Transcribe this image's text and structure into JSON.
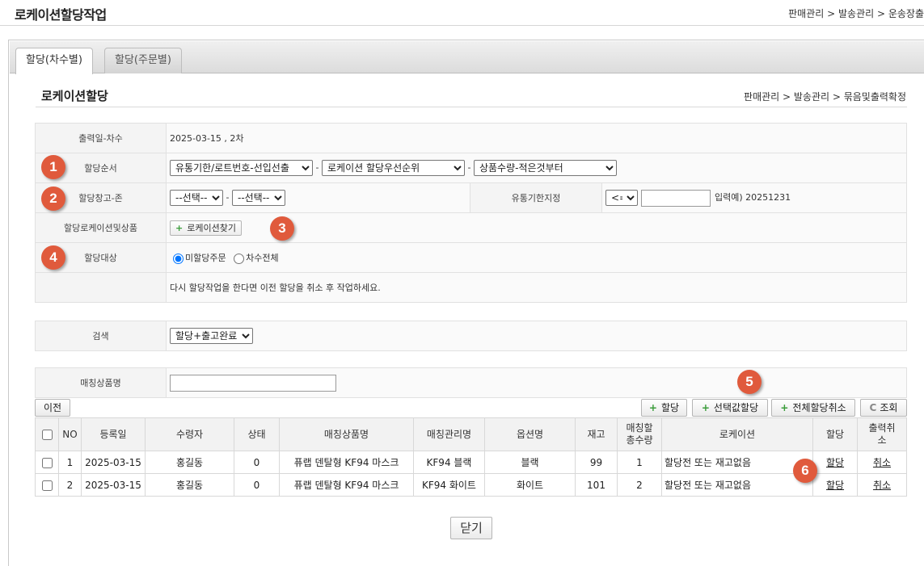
{
  "page": {
    "title": "로케이션할당작업",
    "breadcrumb": "판매관리 > 발송관리 > 운송장출"
  },
  "tabs": [
    {
      "label": "할당(차수별)",
      "active": true
    },
    {
      "label": "할당(주문별)",
      "active": false
    }
  ],
  "section": {
    "title": "로케이션할당",
    "breadcrumb": "판매관리 > 발송관리 > 묶음및출력확정"
  },
  "form": {
    "date_label": "출력일-차수",
    "date_value": "2025-03-15 , 2차",
    "order_label": "할당순서",
    "order_select1": "유통기한/로트번호-선입선출",
    "order_select2": "로케이션 할당우선순위",
    "order_select3": "상품수량-적은것부터",
    "dash": "-",
    "warehouse_label": "할당창고-존",
    "warehouse_select": "--선택--",
    "zone_select": "--선택--",
    "expiry_label": "유통기한지정",
    "expiry_op": "<=",
    "expiry_value": "",
    "expiry_hint": "입력예) 20251231",
    "location_label": "할당로케이션및상품",
    "find_location_button": "로케이션찾기",
    "target_label": "할당대상",
    "radio_unassigned": "미할당주문",
    "radio_all": "차수전체",
    "target_selected": "unassigned",
    "notice": "다시 할당작업을 한다면 이전 할당을 취소 후 작업하세요."
  },
  "search": {
    "label": "검색",
    "select": "할당+출고완료"
  },
  "matching": {
    "label": "매칭상품명",
    "value": ""
  },
  "buttons": {
    "prev": "이전",
    "assign": "할당",
    "assign_selected": "선택값할당",
    "cancel_all": "전체할당취소",
    "refresh": "조회",
    "plus_icon": "+",
    "refresh_icon": "C",
    "close": "닫기"
  },
  "badges": [
    "1",
    "2",
    "3",
    "4",
    "5",
    "6"
  ],
  "table": {
    "headers": {
      "no": "NO",
      "date": "등록일",
      "receiver": "수령자",
      "status": "상태",
      "product": "매칭상품명",
      "manage": "매칭관리명",
      "option": "옵션명",
      "stock": "재고",
      "total_line1": "매칭할",
      "total_line2": "총수량",
      "location": "로케이션",
      "assign": "할당",
      "cancel_line1": "출력취",
      "cancel_line2": "소"
    },
    "rows": [
      {
        "no": "1",
        "date": "2025-03-15",
        "receiver": "홍길동",
        "status": "0",
        "product": "퓨랩 덴탈형 KF94 마스크",
        "manage": "KF94 블랙",
        "option": "블랙",
        "stock": "99",
        "total": "1",
        "location": "할당전 또는 재고없음",
        "assign": "할당",
        "cancel": "취소"
      },
      {
        "no": "2",
        "date": "2025-03-15",
        "receiver": "홍길동",
        "status": "0",
        "product": "퓨랩 덴탈형 KF94 마스크",
        "manage": "KF94 화이트",
        "option": "화이트",
        "stock": "101",
        "total": "2",
        "location": "할당전 또는 재고없음",
        "assign": "할당",
        "cancel": "취소"
      }
    ]
  },
  "colors": {
    "badge": "#e05a3c",
    "error_text": "#d9261c",
    "plus": "#3a9d3a"
  }
}
